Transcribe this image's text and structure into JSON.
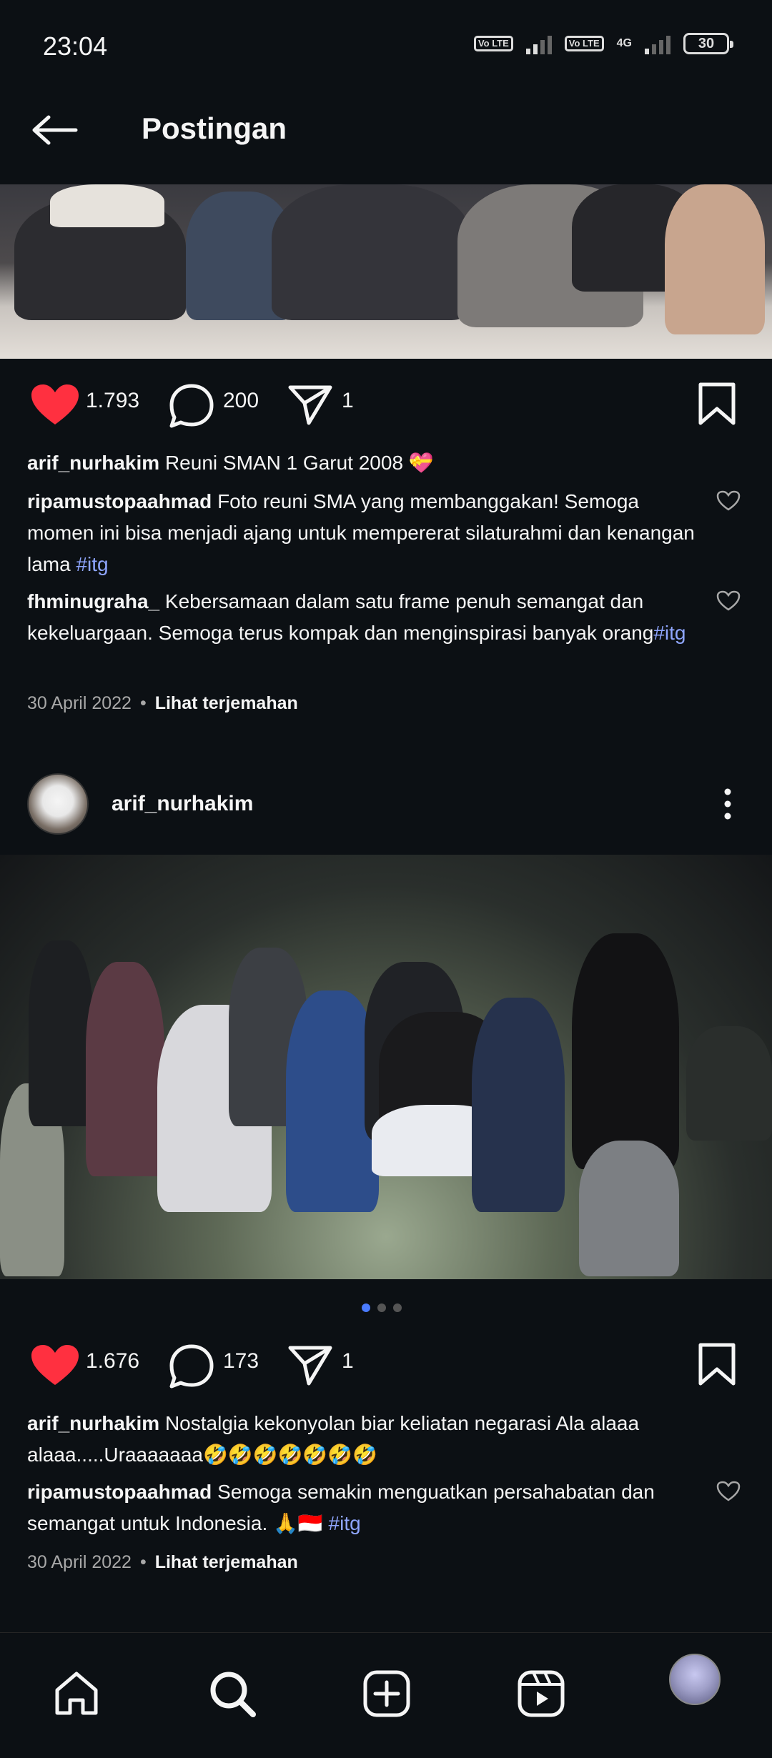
{
  "status_bar": {
    "time": "23:04",
    "sim1_label": "Vo LTE",
    "sim2_label": "Vo LTE",
    "network": "4G",
    "battery": "30"
  },
  "header": {
    "title": "Postingan",
    "back_icon": "arrow-left-icon"
  },
  "posts": [
    {
      "likes": "1.793",
      "comments": "200",
      "shares": "1",
      "caption_user": "arif_nurhakim",
      "caption_text": "Reuni SMAN 1 Garut 2008 💝",
      "comments_list": [
        {
          "user": "ripamustopaahmad",
          "text": "Foto reuni SMA yang membanggakan! Semoga momen ini bisa menjadi ajang untuk mempererat silaturahmi dan kenangan lama ",
          "tag": "#itg"
        },
        {
          "user": "fhminugraha_",
          "text": "Kebersamaan dalam satu frame penuh semangat dan kekeluargaan. Semoga terus kompak dan menginspirasi banyak orang",
          "tag": "#itg"
        }
      ],
      "date": "30 April 2022",
      "translate": "Lihat terjemahan"
    },
    {
      "username": "arif_nurhakim",
      "likes": "1.676",
      "comments": "173",
      "shares": "1",
      "caption_user": "arif_nurhakim",
      "caption_text": "Nostalgia kekonyolan biar keliatan negarasi Ala alaaa alaaa.....Uraaaaaaa🤣🤣🤣🤣🤣🤣🤣",
      "comments_list": [
        {
          "user": "ripamustopaahmad",
          "text": "Semoga semakin menguatkan persahabatan dan semangat untuk Indonesia. 🙏🇮🇩 ",
          "tag": "#itg"
        }
      ],
      "date": "30 April 2022",
      "translate": "Lihat terjemahan",
      "carousel_index": 1,
      "carousel_total": 3
    }
  ],
  "icons": {
    "like": "heart-filled-icon",
    "comment": "comment-bubble-icon",
    "share": "paper-plane-icon",
    "save": "bookmark-icon",
    "comment_like": "heart-outline-icon",
    "more": "more-vertical-icon"
  },
  "colors": {
    "background": "#0c1014",
    "like_red": "#ff3040",
    "hashtag": "#8fa6ff",
    "carousel_active": "#4a7bff"
  },
  "bottom_nav": [
    "home-icon",
    "search-icon",
    "create-icon",
    "reels-icon",
    "profile-avatar"
  ]
}
